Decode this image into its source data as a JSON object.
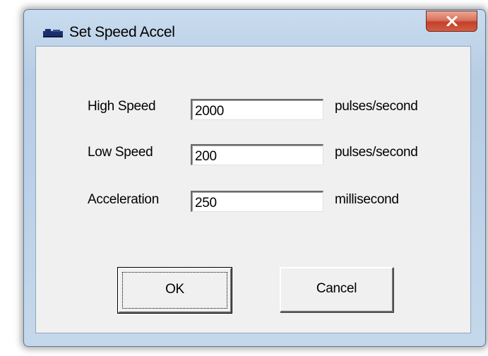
{
  "window": {
    "title": "Set Speed Accel",
    "app_icon": "app-icon",
    "close_icon": "close-icon"
  },
  "fields": {
    "high_speed": {
      "label": "High Speed",
      "value": "2000",
      "unit": "pulses/second"
    },
    "low_speed": {
      "label": "Low Speed",
      "value": "200",
      "unit": "pulses/second"
    },
    "acceleration": {
      "label": "Acceleration",
      "value": "250",
      "unit": "millisecond"
    }
  },
  "buttons": {
    "ok_label": "OK",
    "cancel_label": "Cancel"
  },
  "colors": {
    "close_button": "#c4402a",
    "frame": "#bdd2e8",
    "client_bg": "#f0f0f0"
  }
}
